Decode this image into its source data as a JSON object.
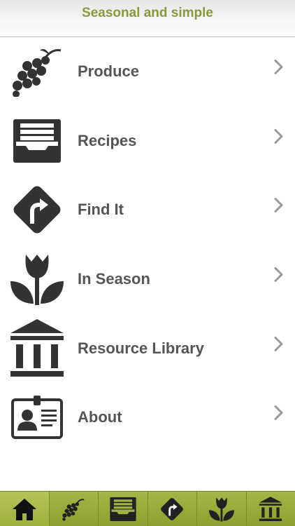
{
  "header": {
    "title": "Seasonal and simple"
  },
  "menu": {
    "items": [
      {
        "label": "Produce",
        "icon": "grapes-icon"
      },
      {
        "label": "Recipes",
        "icon": "recipe-box-icon"
      },
      {
        "label": "Find It",
        "icon": "directions-sign-icon"
      },
      {
        "label": "In Season",
        "icon": "tulip-icon"
      },
      {
        "label": "Resource Library",
        "icon": "library-icon"
      },
      {
        "label": "About",
        "icon": "id-badge-icon"
      }
    ]
  },
  "tabbar": {
    "tabs": [
      {
        "icon": "home-icon",
        "active": true
      },
      {
        "icon": "grapes-icon",
        "active": false
      },
      {
        "icon": "recipe-box-icon",
        "active": false
      },
      {
        "icon": "directions-sign-icon",
        "active": false
      },
      {
        "icon": "tulip-icon",
        "active": false
      },
      {
        "icon": "library-icon",
        "active": false
      }
    ]
  },
  "colors": {
    "title": "#8a9a3a",
    "label": "#555555",
    "tabbar": "#98aa38",
    "icon": "#333333"
  }
}
